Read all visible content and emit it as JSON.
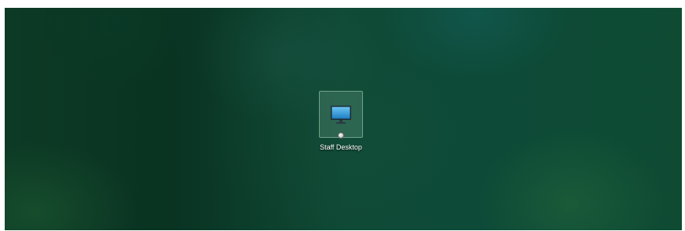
{
  "desktop": {
    "shortcuts": [
      {
        "label": "Staff Desktop",
        "icon": "monitor-icon",
        "overlay_icon": "shortcut-badge-icon"
      }
    ]
  },
  "colors": {
    "wallpaper_base": "#0d4a38",
    "selection_border": "#aad2be",
    "monitor_screen": "#2f9ddc",
    "label_text": "#ffffff"
  }
}
